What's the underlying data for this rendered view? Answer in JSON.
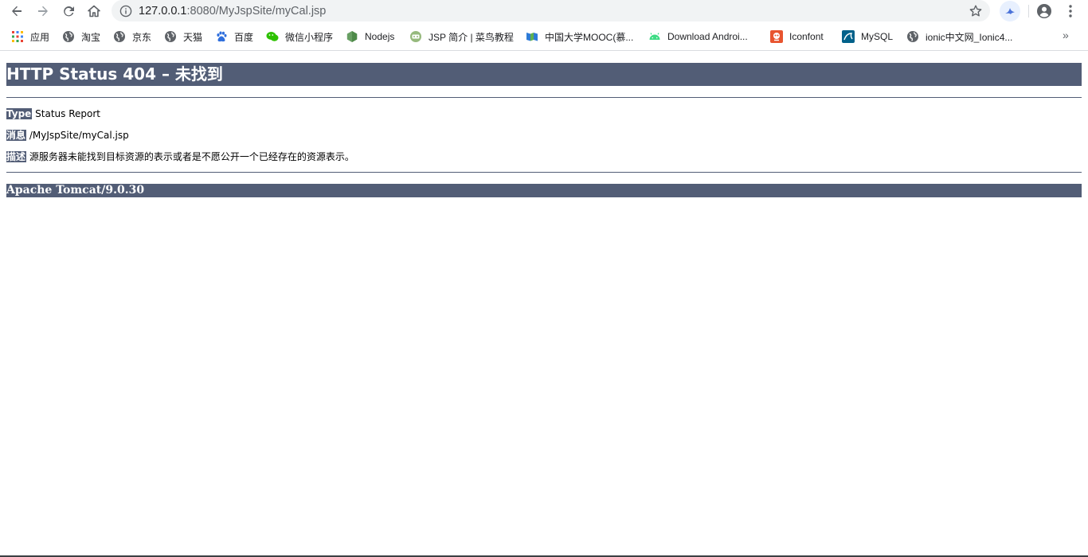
{
  "browser": {
    "url_host": "127.0.0.1",
    "url_rest": ":8080/MyJspSite/myCal.jsp",
    "icons": [
      "back-arrow-icon",
      "forward-arrow-icon",
      "reload-icon",
      "home-icon",
      "site-info-icon",
      "bookmark-star-icon",
      "extension-bird-icon",
      "profile-icon",
      "kebab-menu-icon"
    ]
  },
  "bookmarks": {
    "items": [
      {
        "label": "应用",
        "icon": "apps-grid-icon"
      },
      {
        "label": "淘宝",
        "icon": "globe-icon"
      },
      {
        "label": "京东",
        "icon": "globe-icon"
      },
      {
        "label": "天猫",
        "icon": "globe-icon"
      },
      {
        "label": "百度",
        "icon": "baidu-paw-icon"
      },
      {
        "label": "微信小程序",
        "icon": "wechat-icon"
      },
      {
        "label": "Nodejs",
        "icon": "nodejs-hexagon-icon"
      },
      {
        "label": "JSP 简介 | 菜鸟教程",
        "icon": "runoob-icon"
      },
      {
        "label": "中国大学MOOC(慕...",
        "icon": "mooc-icon"
      },
      {
        "label": "Download Androi...",
        "icon": "android-icon"
      },
      {
        "label": "Iconfont",
        "icon": "iconfont-icon"
      },
      {
        "label": "MySQL",
        "icon": "mysql-icon"
      },
      {
        "label": "ionic中文网_Ionic4...",
        "icon": "globe-icon"
      }
    ],
    "more": "»"
  },
  "page": {
    "title": "HTTP Status 404 – 未找到",
    "type_label": "Type",
    "type_value": "Status Report",
    "message_label": "消息",
    "message_value": "/MyJspSite/myCal.jsp",
    "description_label": "描述",
    "description_value": "源服务器未能找到目标资源的表示或者是不愿公开一个已经存在的资源表示。",
    "footer": "Apache Tomcat/9.0.30"
  },
  "colors": {
    "tomcat_header": "#525d76",
    "toolbar_icon": "#5f6368",
    "omnibox_bg": "#f1f3f4"
  }
}
